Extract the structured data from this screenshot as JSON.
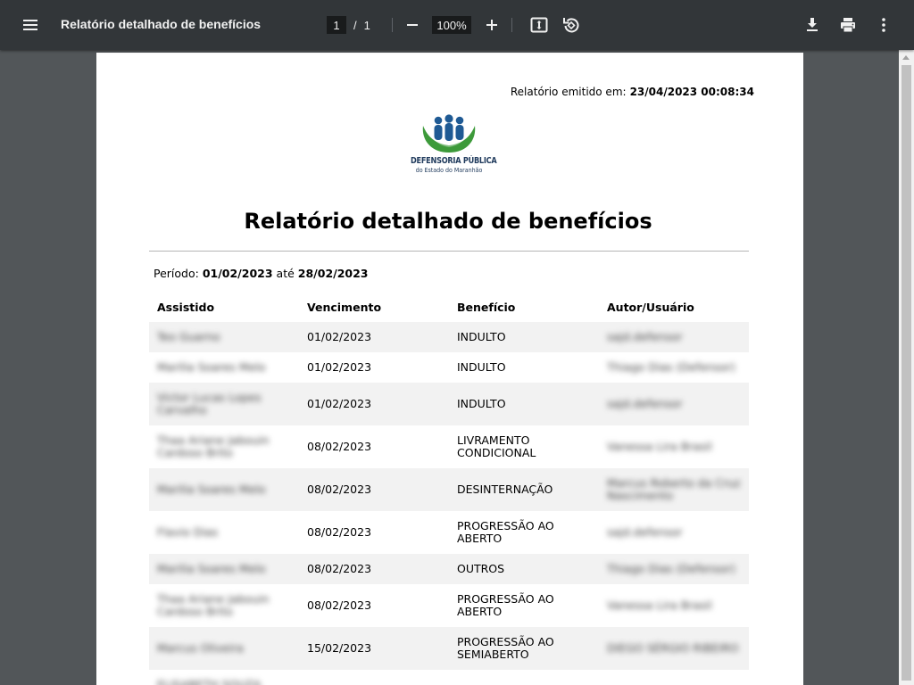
{
  "toolbar": {
    "title": "Relatório detalhado de benefícios",
    "current_page": "1",
    "page_separator": "/",
    "total_pages": "1",
    "zoom": "100%"
  },
  "document": {
    "emitted_label": "Relatório emitido em:",
    "emitted_value": "23/04/2023 00:08:34",
    "logo_title": "DEFENSORIA PÚBLICA",
    "logo_subtitle": "do Estado do Maranhão",
    "title": "Relatório detalhado de benefícios",
    "period_label": "Período:",
    "period_start": "01/02/2023",
    "period_connector": "até",
    "period_end": "28/02/2023",
    "columns": [
      "Assistido",
      "Vencimento",
      "Benefício",
      "Autor/Usuário"
    ],
    "rows": [
      {
        "assistido": "Teo Guarno",
        "vencimento": "01/02/2023",
        "beneficio": "INDULTO",
        "autor": "sajd.defensor"
      },
      {
        "assistido": "Marilia Soares Melo",
        "vencimento": "01/02/2023",
        "beneficio": "INDULTO",
        "autor": "Thiago Dias (Defensor)"
      },
      {
        "assistido": "Victor Lucas Lopes Carvalho",
        "vencimento": "01/02/2023",
        "beneficio": "INDULTO",
        "autor": "sajd.defensor"
      },
      {
        "assistido": "Thaa Ariane Jabouin Cardoso Brito",
        "vencimento": "08/02/2023",
        "beneficio": "LIVRAMENTO CONDICIONAL",
        "autor": "Vanessa Lira Brasil"
      },
      {
        "assistido": "Marilia Soares Melo",
        "vencimento": "08/02/2023",
        "beneficio": "DESINTERNAÇÃO",
        "autor": "Marcus Roberto da Cruz Nascimento"
      },
      {
        "assistido": "Flavio Dias",
        "vencimento": "08/02/2023",
        "beneficio": "PROGRESSÃO AO ABERTO",
        "autor": "sajd.defensor"
      },
      {
        "assistido": "Marilia Soares Melo",
        "vencimento": "08/02/2023",
        "beneficio": "OUTROS",
        "autor": "Thiago Dias (Defensor)"
      },
      {
        "assistido": "Thaa Ariane Jabouin Cardoso Brito",
        "vencimento": "08/02/2023",
        "beneficio": "PROGRESSÃO AO ABERTO",
        "autor": "Vanessa Lira Brasil"
      },
      {
        "assistido": "Marcus Oliveira",
        "vencimento": "15/02/2023",
        "beneficio": "PROGRESSÃO AO SEMIABERTO",
        "autor": "DIEGO SÉRGIO RIBEIRO"
      },
      {
        "assistido": "ELISABETH SOUZA",
        "vencimento": "",
        "beneficio": "",
        "autor": ""
      }
    ]
  },
  "colors": {
    "toolbar_bg": "#323639",
    "viewer_bg": "#525659",
    "logo_blue": "#1f5a94",
    "logo_green": "#3d9a3a"
  },
  "icons": [
    "menu-icon",
    "fit-page-icon",
    "rotate-icon",
    "download-icon",
    "print-icon",
    "more-vert-icon"
  ]
}
